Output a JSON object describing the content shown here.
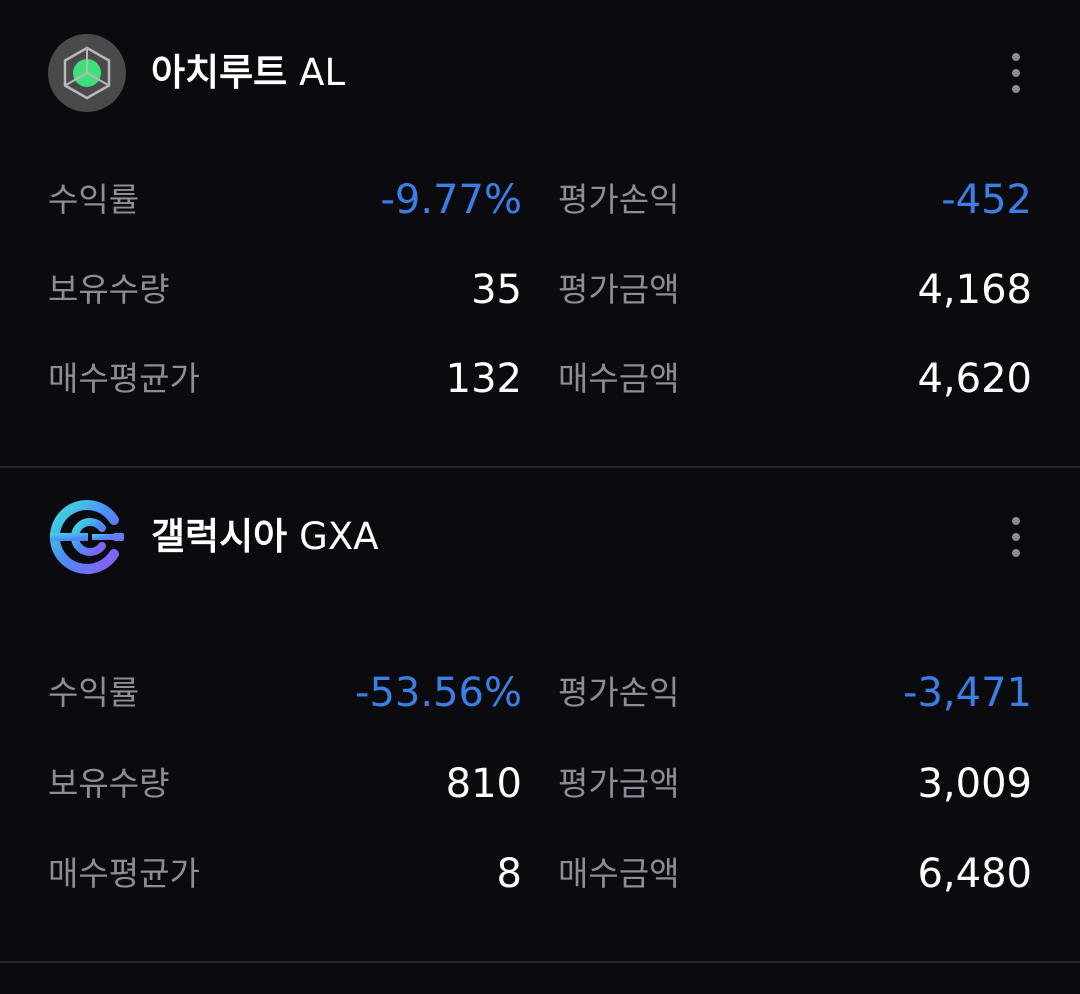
{
  "colors": {
    "background": "#0b0b0f",
    "divider": "#23262d",
    "label": "#8b8e96",
    "value": "#ffffff",
    "negative": "#3b7fe6"
  },
  "labels": {
    "return_rate": "수익률",
    "eval_pnl": "평가손익",
    "holding_qty": "보유수량",
    "eval_amount": "평가금액",
    "avg_buy_price": "매수평균가",
    "buy_amount": "매수금액"
  },
  "holdings": [
    {
      "name": "아치루트",
      "ticker": "AL",
      "icon": "archloot-logo-icon",
      "return_rate": "-9.77%",
      "eval_pnl": "-452",
      "holding_qty": "35",
      "eval_amount": "4,168",
      "avg_buy_price": "132",
      "buy_amount": "4,620"
    },
    {
      "name": "갤럭시아",
      "ticker": "GXA",
      "icon": "galaxia-logo-icon",
      "return_rate": "-53.56%",
      "eval_pnl": "-3,471",
      "holding_qty": "810",
      "eval_amount": "3,009",
      "avg_buy_price": "8",
      "buy_amount": "6,480"
    }
  ]
}
